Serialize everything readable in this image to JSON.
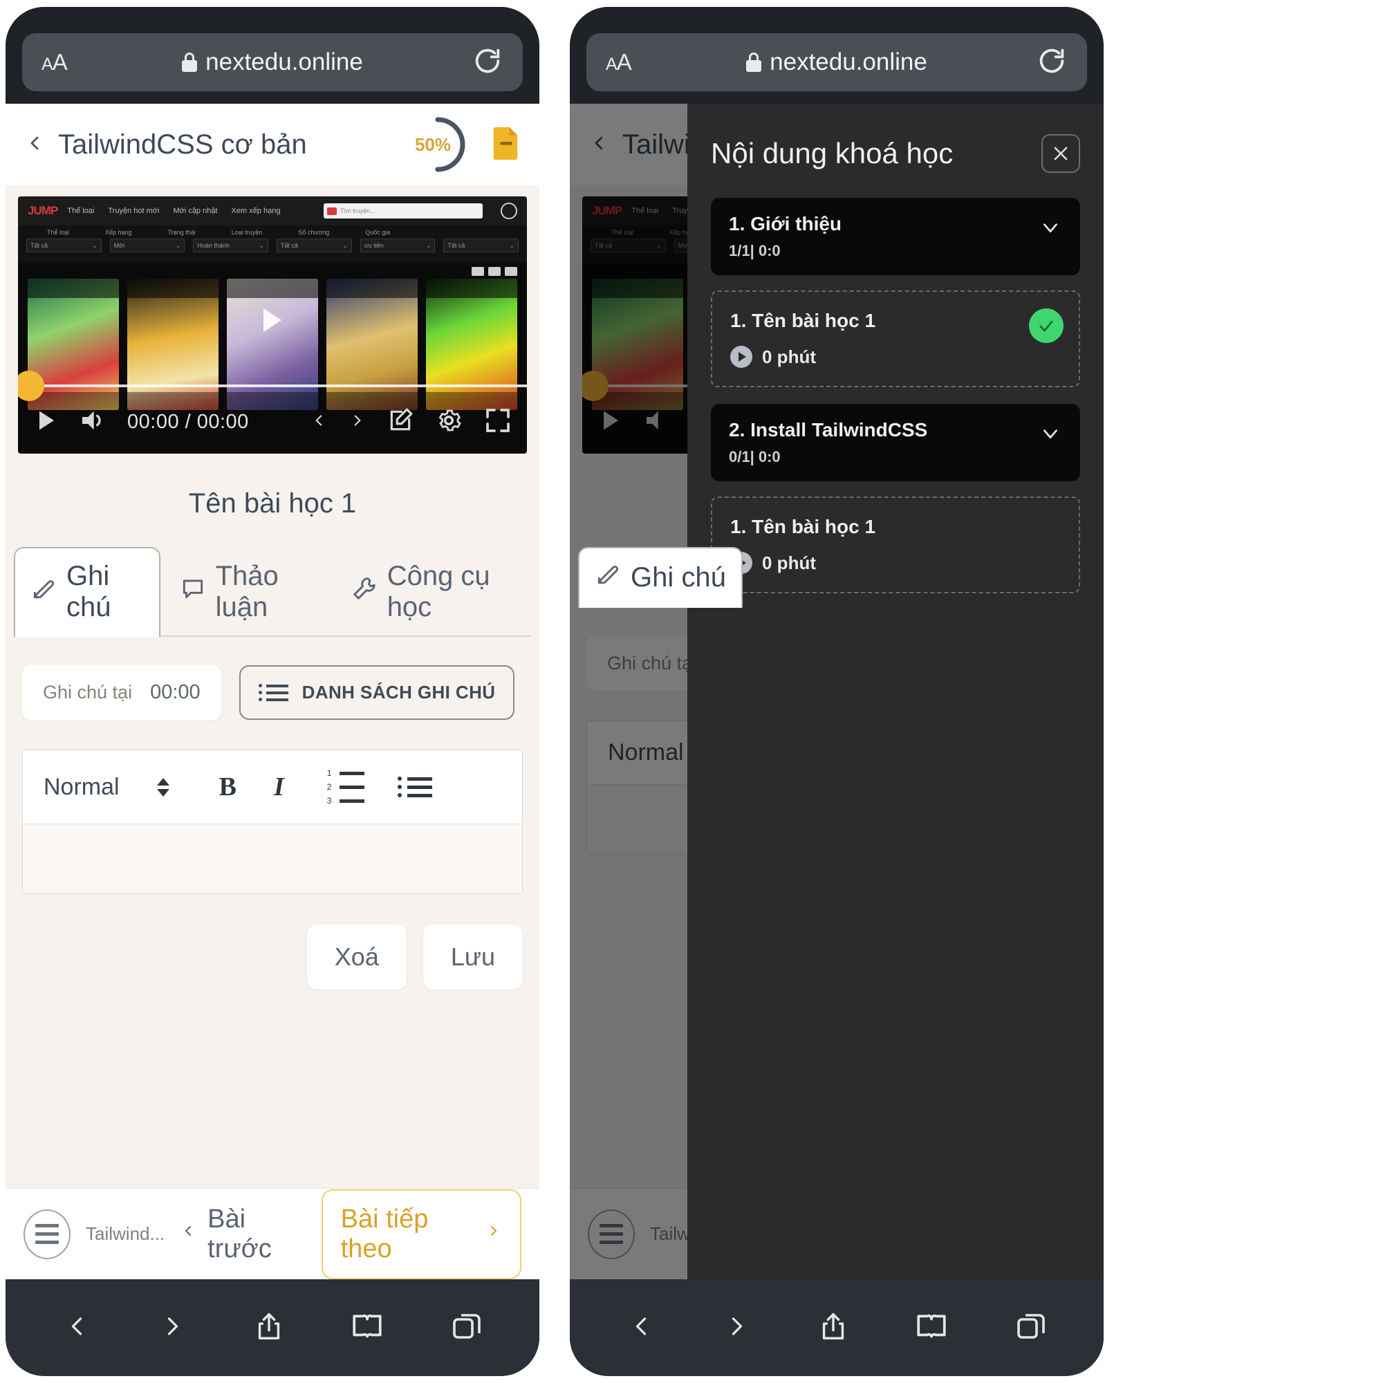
{
  "browser": {
    "aa_label": "AA",
    "url": "nextedu.online",
    "lock_icon": "lock-icon",
    "reload_icon": "reload-icon",
    "toolbar": [
      {
        "name": "back-icon",
        "label": "Back"
      },
      {
        "name": "forward-icon",
        "label": "Forward"
      },
      {
        "name": "share-icon",
        "label": "Share"
      },
      {
        "name": "bookmarks-icon",
        "label": "Bookmarks"
      },
      {
        "name": "tabs-icon",
        "label": "Tabs"
      }
    ]
  },
  "course": {
    "back_icon": "chevron-left-icon",
    "title": "TailwindCSS cơ bản",
    "progress_percent": 50,
    "progress_label": "50%",
    "document_icon": "document-icon",
    "accent_yellow": "#f0b429",
    "progress_ring_color": "#4a5561"
  },
  "player": {
    "current_time": "00:00",
    "total_time": "00:00",
    "time_display": "00:00 / 00:00",
    "play_icon": "play-icon",
    "volume_icon": "volume-icon",
    "prev_icon": "chevron-left-icon",
    "next_icon": "chevron-right-icon",
    "edit_icon": "edit-icon",
    "settings_icon": "gear-icon",
    "fullscreen_icon": "fullscreen-icon",
    "thumbnail": {
      "site_logo": "JUMP",
      "menu": [
        "Thể loại",
        "Truyện hot mới",
        "Mới cập nhật",
        "Xem xếp hạng"
      ],
      "search_placeholder": "Tìm truyện...",
      "filter_labels": [
        "Thể loại",
        "Xếp hạng",
        "Trạng thái",
        "Loại truyện",
        "Số chương",
        "Quốc gia"
      ],
      "filter_values": [
        "Tất cả",
        "Mới",
        "Hoàn thành",
        "Tất cả",
        "ưu tiên",
        "Tất cả"
      ]
    }
  },
  "lesson": {
    "title": "Tên bài học 1"
  },
  "tabs": [
    {
      "label": "Ghi chú",
      "icon": "pencil-note-icon",
      "active": true
    },
    {
      "label": "Thảo luận",
      "icon": "speech-bubble-icon",
      "active": false
    },
    {
      "label": "Công cụ học",
      "icon": "wrench-icon",
      "active": false
    }
  ],
  "note": {
    "at_label": "Ghi chú tại",
    "at_time": "00:00",
    "list_button": "DANH SÁCH GHI CHÚ",
    "list_icon": "list-icon",
    "editor": {
      "format": "Normal",
      "format_caret_icon": "up-down-caret-icon",
      "bold": "B",
      "italic": "I",
      "ordered_list_icon": "ordered-list-icon",
      "bullet_list_icon": "bullet-list-icon",
      "content": ""
    },
    "delete_button": "Xoá",
    "save_button": "Lưu"
  },
  "course_bottom": {
    "menu_icon": "hamburger-menu-icon",
    "course_short": "Tailwind...",
    "prev_label": "Bài trước",
    "prev_icon": "chevron-left-icon",
    "next_label": "Bài tiếp theo",
    "next_icon": "chevron-right-icon"
  },
  "drawer": {
    "title": "Nội dung khoá học",
    "close_icon": "close-icon",
    "sections": [
      {
        "title": "1. Giới thiệu",
        "meta": "1/1| 0:0",
        "chevron_icon": "chevron-down-icon",
        "lessons": [
          {
            "name": "1. Tên bài học 1",
            "duration": "0 phút",
            "play_icon": "play-circle-icon",
            "completed": true,
            "check_icon": "check-icon"
          }
        ]
      },
      {
        "title": "2. Install TailwindCSS",
        "meta": "0/1| 0:0",
        "chevron_icon": "chevron-down-icon",
        "lessons": [
          {
            "name": "1. Tên bài học 1",
            "duration": "0 phút",
            "play_icon": "play-circle-icon",
            "completed": false,
            "check_icon": ""
          }
        ]
      }
    ]
  }
}
